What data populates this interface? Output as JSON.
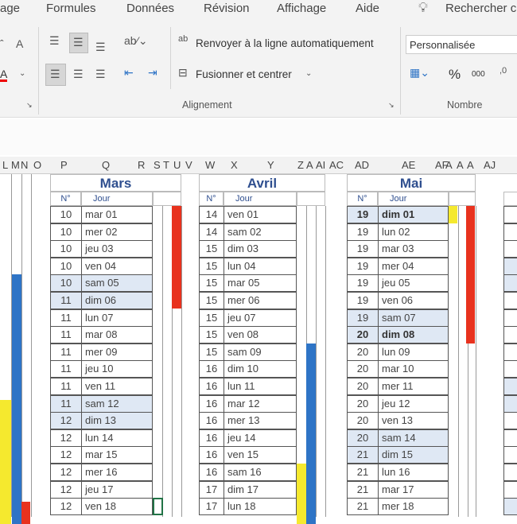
{
  "ribbon_tabs": [
    "age",
    "Formules",
    "Données",
    "Révision",
    "Affichage",
    "Aide"
  ],
  "search": {
    "icon": "lightbulb-icon",
    "label": "Rechercher c"
  },
  "alignment": {
    "wrap_label": "Renvoyer à la ligne automatiquement",
    "merge_label": "Fusionner et centrer",
    "group_label": "Alignement"
  },
  "number": {
    "format_value": "Personnalisée",
    "percent": "%",
    "thousands": "000",
    "group_label": "Nombre"
  },
  "column_headers": [
    "L",
    "M",
    "N",
    "O",
    "P",
    "Q",
    "R",
    "S",
    "T",
    "U",
    "V",
    "W",
    "X",
    "Y",
    "Z",
    "A",
    "AI",
    "AC",
    "AD",
    "AE",
    "AF",
    "A",
    "A",
    "A",
    "AJ"
  ],
  "col_sub": {
    "num": "N°",
    "day": "Jour"
  },
  "colors": {
    "red": "#e8321e",
    "blue": "#2e74c6",
    "yellow": "#f5e92e",
    "weekend": "#dfe8f4",
    "month_title": "#2f4f8f"
  },
  "months": [
    {
      "name": "Mars",
      "rows": [
        [
          "10",
          "mar 01"
        ],
        [
          "10",
          "mer 02"
        ],
        [
          "10",
          "jeu 03"
        ],
        [
          "10",
          "ven 04"
        ],
        [
          "10",
          "sam 05",
          1
        ],
        [
          "11",
          "dim 06",
          1
        ],
        [
          "11",
          "lun 07"
        ],
        [
          "11",
          "mar 08"
        ],
        [
          "11",
          "mer 09"
        ],
        [
          "11",
          "jeu 10"
        ],
        [
          "11",
          "ven 11"
        ],
        [
          "11",
          "sam 12",
          1
        ],
        [
          "12",
          "dim 13",
          1
        ],
        [
          "12",
          "lun 14"
        ],
        [
          "12",
          "mar 15"
        ],
        [
          "12",
          "mer 16"
        ],
        [
          "12",
          "jeu 17"
        ],
        [
          "12",
          "ven 18"
        ]
      ]
    },
    {
      "name": "Avril",
      "rows": [
        [
          "14",
          "ven 01"
        ],
        [
          "14",
          "sam 02"
        ],
        [
          "15",
          "dim 03"
        ],
        [
          "15",
          "lun 04"
        ],
        [
          "15",
          "mar 05"
        ],
        [
          "15",
          "mer 06"
        ],
        [
          "15",
          "jeu 07"
        ],
        [
          "15",
          "ven 08"
        ],
        [
          "15",
          "sam 09"
        ],
        [
          "16",
          "dim 10"
        ],
        [
          "16",
          "lun 11"
        ],
        [
          "16",
          "mar 12"
        ],
        [
          "16",
          "mer 13"
        ],
        [
          "16",
          "jeu 14"
        ],
        [
          "16",
          "ven 15"
        ],
        [
          "16",
          "sam 16"
        ],
        [
          "17",
          "dim 17"
        ],
        [
          "17",
          "lun 18"
        ]
      ]
    },
    {
      "name": "Mai",
      "rows": [
        [
          "19",
          "dim 01",
          1,
          1
        ],
        [
          "19",
          "lun 02"
        ],
        [
          "19",
          "mar 03"
        ],
        [
          "19",
          "mer 04"
        ],
        [
          "19",
          "jeu 05"
        ],
        [
          "19",
          "ven 06"
        ],
        [
          "19",
          "sam 07",
          1
        ],
        [
          "20",
          "dim 08",
          1,
          1
        ],
        [
          "20",
          "lun 09"
        ],
        [
          "20",
          "mar 10"
        ],
        [
          "20",
          "mer 11"
        ],
        [
          "20",
          "jeu 12"
        ],
        [
          "20",
          "ven 13"
        ],
        [
          "20",
          "sam 14",
          1
        ],
        [
          "21",
          "dim 15",
          1
        ],
        [
          "21",
          "lun 16"
        ],
        [
          "21",
          "mar 17"
        ],
        [
          "21",
          "mer 18"
        ]
      ]
    }
  ]
}
